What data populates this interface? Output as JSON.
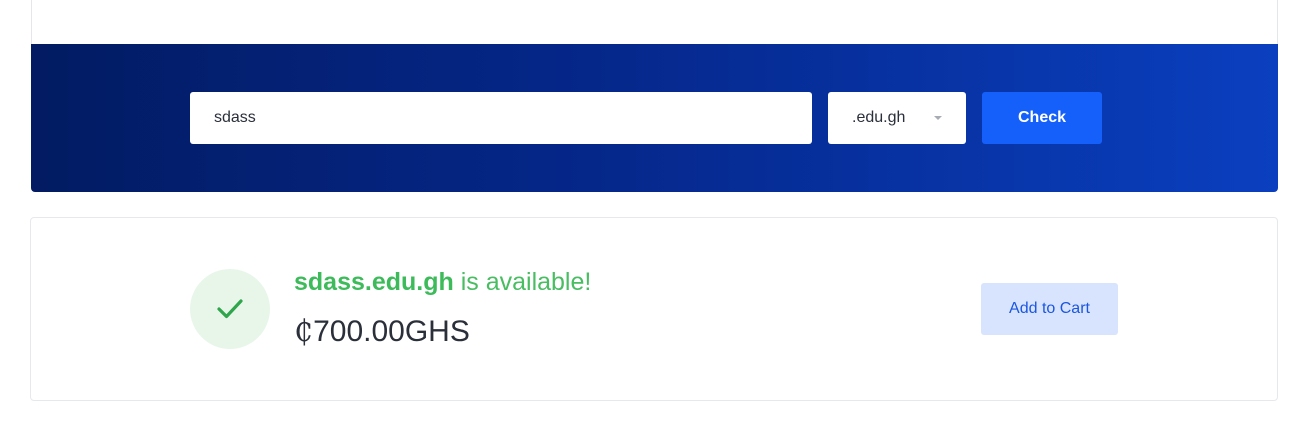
{
  "search": {
    "domain_value": "sdass",
    "tld_selected": ".edu.gh",
    "check_label": "Check"
  },
  "result": {
    "domain": "sdass.edu.gh",
    "status_text": " is available!",
    "currency_symbol": "₵",
    "price": "700.00GHS",
    "add_to_cart_label": "Add to Cart"
  },
  "colors": {
    "banner_start": "#021b62",
    "banner_end": "#0a3fbf",
    "primary_button": "#1560fb",
    "success": "#3dbb5a",
    "success_bg": "#e8f6ea",
    "secondary_button_bg": "#d8e4fd",
    "secondary_button_text": "#1b56e0"
  },
  "icons": {
    "dropdown": "caret-down-icon",
    "status": "check-icon"
  }
}
